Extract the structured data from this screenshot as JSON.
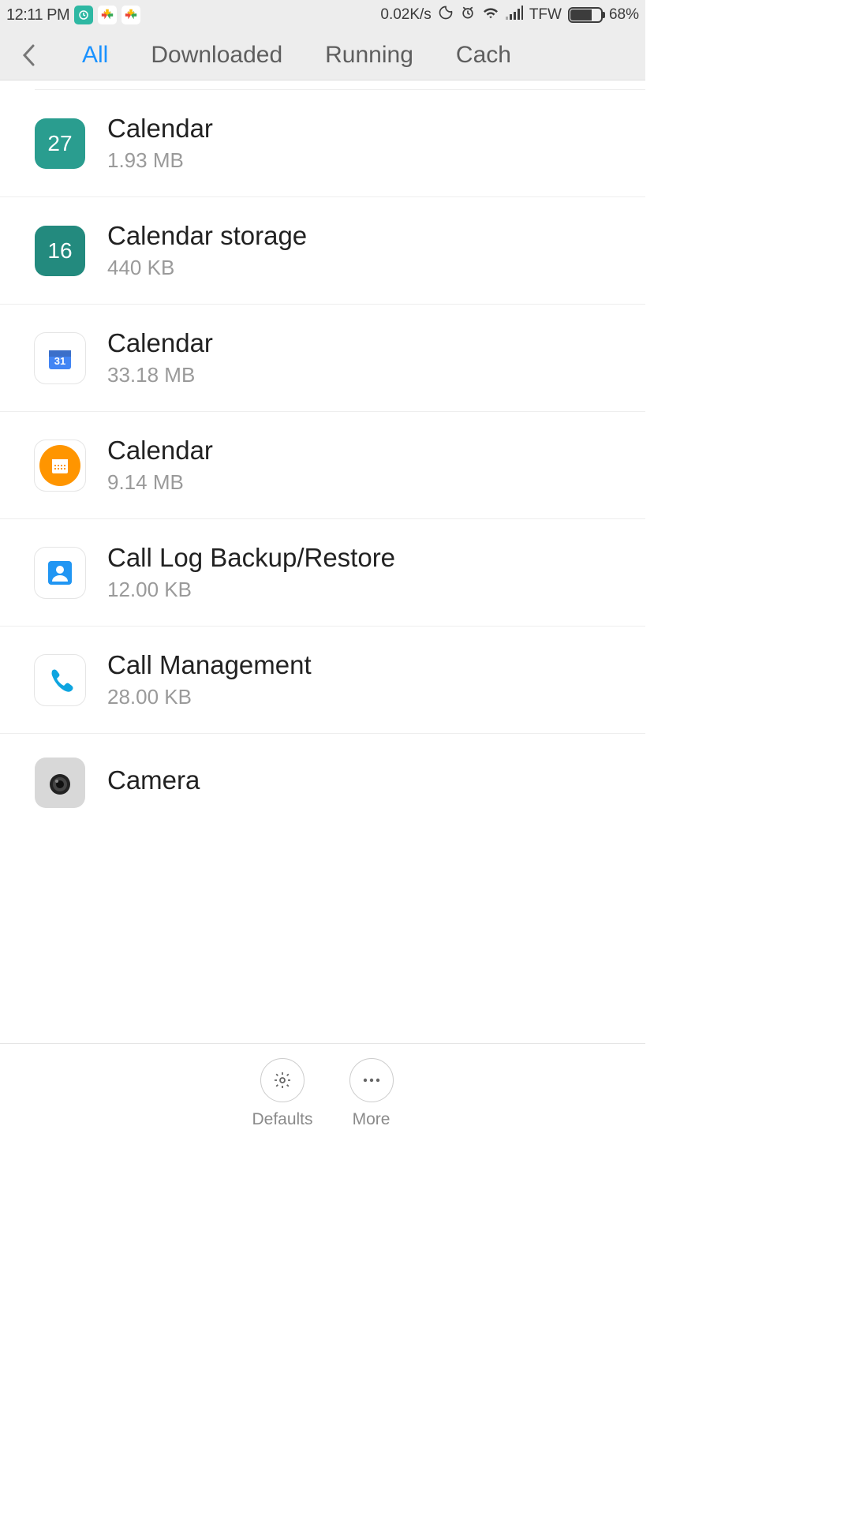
{
  "status": {
    "time": "12:11 PM",
    "network_speed": "0.02K/s",
    "carrier": "TFW",
    "battery_pct": "68%"
  },
  "tabs": {
    "all": "All",
    "downloaded": "Downloaded",
    "running": "Running",
    "cached": "Cach"
  },
  "apps": [
    {
      "name": "Calendar",
      "size": "1.93 MB",
      "icon_text": "27",
      "icon_type": "teal"
    },
    {
      "name": "Calendar storage",
      "size": "440 KB",
      "icon_text": "16",
      "icon_type": "teal-alt"
    },
    {
      "name": "Calendar",
      "size": "33.18 MB",
      "icon_text": "31",
      "icon_type": "google-cal"
    },
    {
      "name": "Calendar",
      "size": "9.14 MB",
      "icon_text": "",
      "icon_type": "orange-cal"
    },
    {
      "name": "Call Log Backup/Restore",
      "size": "12.00 KB",
      "icon_text": "",
      "icon_type": "contacts"
    },
    {
      "name": "Call Management",
      "size": "28.00 KB",
      "icon_text": "",
      "icon_type": "phone"
    },
    {
      "name": "Camera",
      "size": "",
      "icon_text": "",
      "icon_type": "camera"
    }
  ],
  "bottom": {
    "defaults": "Defaults",
    "more": "More"
  }
}
